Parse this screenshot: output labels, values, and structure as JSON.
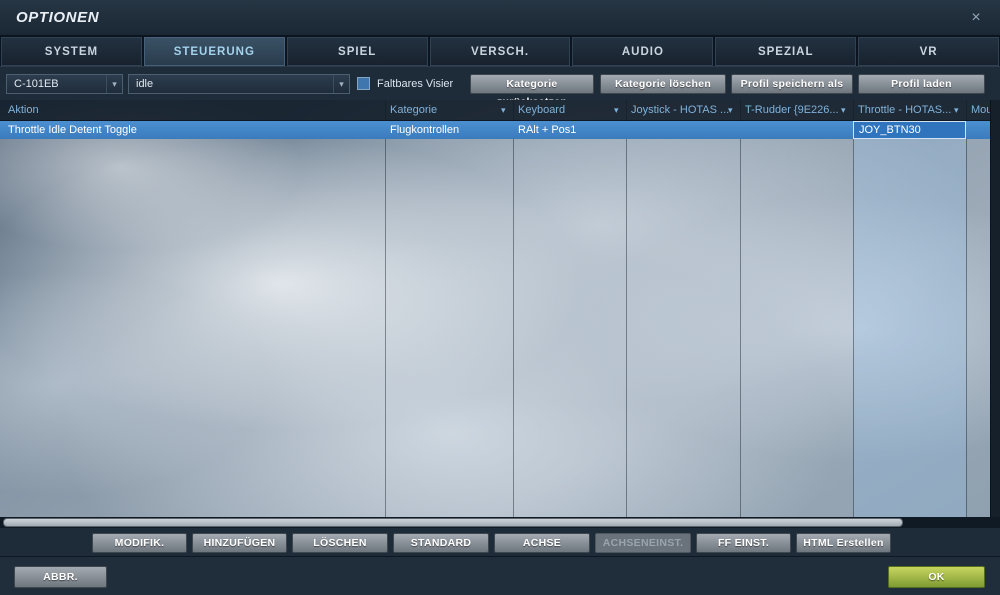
{
  "icons": {
    "close": "×",
    "caret": "▾"
  },
  "window": {
    "title": "OPTIONEN"
  },
  "tabs": [
    {
      "label": "SYSTEM"
    },
    {
      "label": "STEUERUNG"
    },
    {
      "label": "SPIEL"
    },
    {
      "label": "VERSCH."
    },
    {
      "label": "AUDIO"
    },
    {
      "label": "SPEZIAL"
    },
    {
      "label": "VR"
    }
  ],
  "toolbar": {
    "aircraft_select_value": "C-101EB",
    "filter_select_value": "idle",
    "checkbox_label": "Faltbares Visier",
    "buttons": [
      "Kategorie zurücksetzen",
      "Kategorie löschen",
      "Profil speichern als",
      "Profil laden"
    ]
  },
  "table": {
    "columns": [
      {
        "label": "Aktion"
      },
      {
        "label": "Kategorie"
      },
      {
        "label": "Keyboard"
      },
      {
        "label": "Joystick - HOTAS ..."
      },
      {
        "label": "T-Rudder {9E226..."
      },
      {
        "label": "Throttle - HOTAS..."
      },
      {
        "label": "Mou"
      }
    ],
    "rows": [
      {
        "aktion": "Throttle Idle Detent Toggle",
        "kategorie": "Flugkontrollen",
        "keyboard": "RAlt + Pos1",
        "joystick": "",
        "t_rudder": "",
        "throttle": "JOY_BTN30",
        "mouse": ""
      }
    ]
  },
  "actions": [
    {
      "label": "MODIFIK."
    },
    {
      "label": "HINZUFÜGEN"
    },
    {
      "label": "LÖSCHEN"
    },
    {
      "label": "STANDARD"
    },
    {
      "label": "ACHSE"
    },
    {
      "label": "ACHSENEINST."
    },
    {
      "label": "FF EINST."
    },
    {
      "label": "HTML Erstellen"
    }
  ],
  "footer": {
    "cancel": "ABBR.",
    "ok": "OK"
  },
  "colors": {
    "accent_selection": "#3a7bbc",
    "header_text": "#7fb2da",
    "ok_green": "#8faf3c"
  }
}
